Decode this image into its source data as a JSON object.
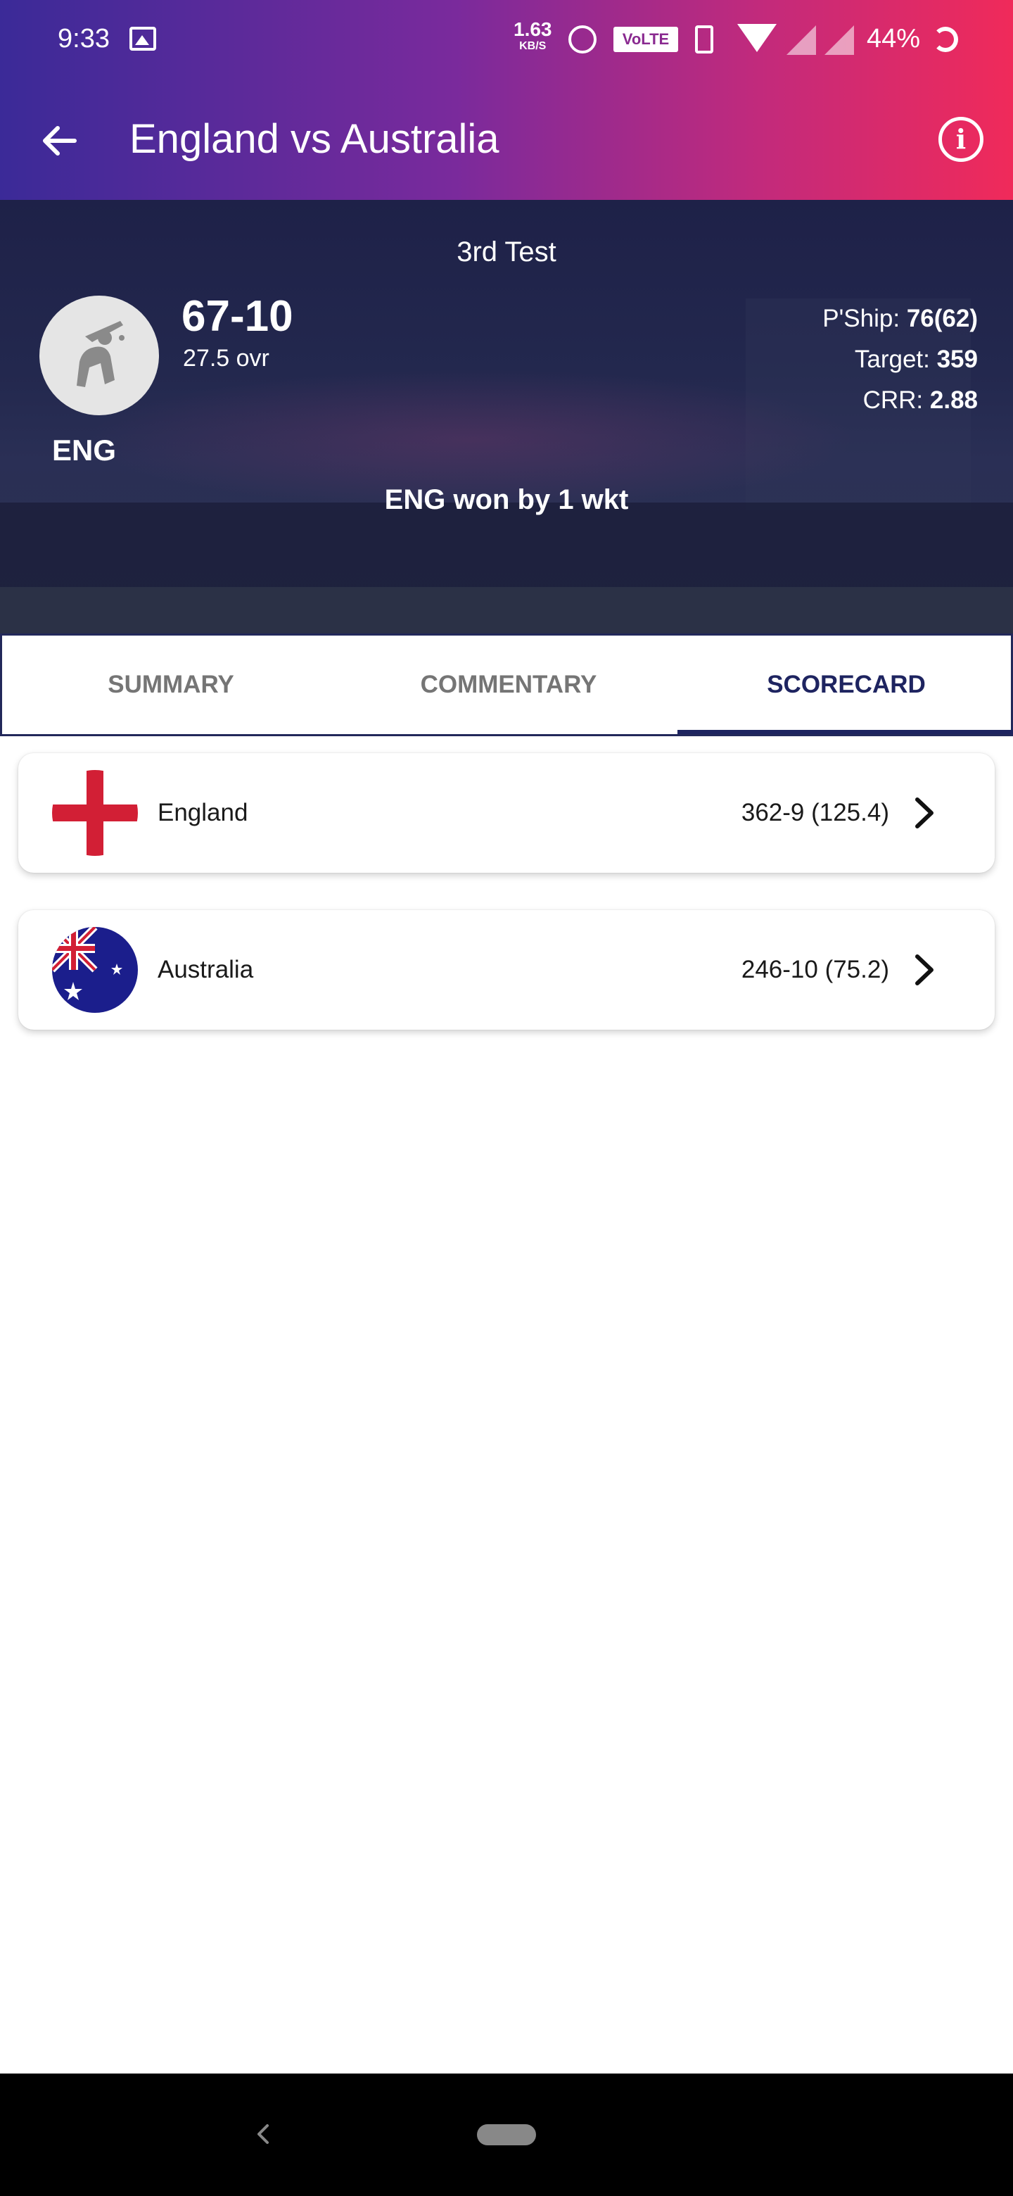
{
  "status_bar": {
    "time": "9:33",
    "speed_value": "1.63",
    "speed_unit": "KB/S",
    "volte": "VoLTE",
    "battery": "44%"
  },
  "app_bar": {
    "title": "England vs Australia"
  },
  "match": {
    "type": "3rd Test",
    "score": "67-10",
    "overs": "27.5 ovr",
    "team_code": "ENG",
    "pship_label": "P'Ship:",
    "pship_value": "76(62)",
    "target_label": "Target:",
    "target_value": "359",
    "crr_label": "CRR:",
    "crr_value": "2.88",
    "result": "ENG won by 1 wkt"
  },
  "tabs": [
    {
      "label": "SUMMARY",
      "active": false
    },
    {
      "label": "COMMENTARY",
      "active": false
    },
    {
      "label": "SCORECARD",
      "active": true
    }
  ],
  "innings": [
    {
      "team": "England",
      "score": "362-9 (125.4)",
      "flag_icon": "england-flag-icon"
    },
    {
      "team": "Australia",
      "score": "246-10 (75.2)",
      "flag_icon": "australia-flag-icon"
    }
  ],
  "colors": {
    "accent": "#1e2460",
    "gradient_start": "#3b2a98",
    "gradient_end": "#f02a5a",
    "england_red": "#d21f35",
    "australia_blue": "#1b1e8c"
  }
}
